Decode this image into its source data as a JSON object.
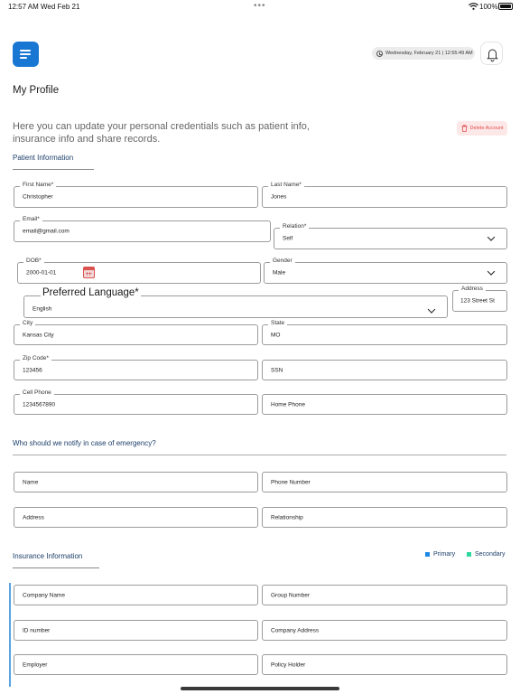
{
  "status_bar": {
    "time": "12:57 AM",
    "date": "Wed Feb 21",
    "battery": "100%"
  },
  "header": {
    "datetime": "Wednesday, February 21 | 12:55:49 AM"
  },
  "page": {
    "title": "My Profile",
    "intro": "Here you can update your personal credentials such as patient info, insurance info and share records.",
    "delete_label": "Delete Account"
  },
  "patient": {
    "section_title": "Patient Information",
    "first_name": {
      "label": "First Name*",
      "value": "Christopher"
    },
    "last_name": {
      "label": "Last Name*",
      "value": "Jones"
    },
    "email": {
      "label": "Email*",
      "value": "email@gmail.com"
    },
    "relation": {
      "label": "Relation*",
      "value": "Self"
    },
    "dob": {
      "label": "DOB*",
      "value": "2000-01-01"
    },
    "gender": {
      "label": "Gender",
      "value": "Male"
    },
    "language": {
      "label": "Preferred Language*",
      "value": "English"
    },
    "address": {
      "label": "Address",
      "value": "123 Street St"
    },
    "city": {
      "label": "City",
      "value": "Kansas City"
    },
    "state": {
      "label": "State",
      "value": "MO"
    },
    "zip": {
      "label": "Zip Code*",
      "value": "123456"
    },
    "ssn": {
      "placeholder": "SSN"
    },
    "cell_phone": {
      "label": "Cell Phone",
      "value": "1234567890"
    },
    "home_phone": {
      "placeholder": "Home Phone"
    }
  },
  "emergency": {
    "section_title": "Who should we notify in case of emergency?",
    "name": "Name",
    "phone": "Phone Number",
    "address": "Address",
    "relationship": "Relationship"
  },
  "insurance": {
    "section_title": "Insurance Information",
    "legend": [
      {
        "label": "Primary",
        "color": "#1e88e5"
      },
      {
        "label": "Secondary",
        "color": "#2ed8a0"
      }
    ],
    "company_name": "Company Name",
    "group_number": "Group Number",
    "id_number": "ID number",
    "company_address": "Company Address",
    "employer": "Employer",
    "policy_holder": "Policy Holder"
  },
  "colors": {
    "accent": "#1877d2",
    "danger": "#e14b4b",
    "section_title": "#1d3f6a"
  }
}
